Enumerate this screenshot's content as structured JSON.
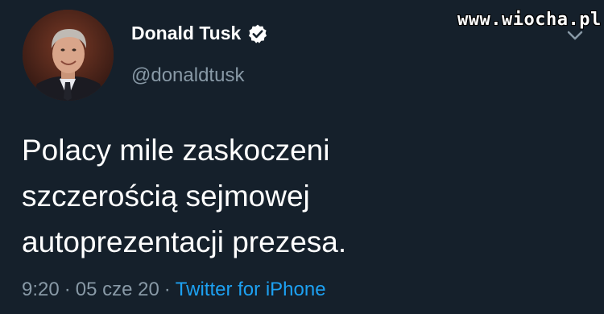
{
  "watermark": {
    "text": "www.wiocha.pl"
  },
  "author": {
    "display_name": "Donald Tusk",
    "handle": "@donaldtusk",
    "verified": true,
    "avatar_icon": "profile-photo"
  },
  "tweet": {
    "text_lines": [
      "Polacy mile zaskoczeni",
      "szczerością sejmowej",
      "autoprezentacji prezesa."
    ],
    "time": "9:20",
    "separator": "·",
    "date": "05 cze 20",
    "source": "Twitter for iPhone"
  },
  "icons": {
    "verified": "verified-badge-icon",
    "menu": "chevron-down-icon"
  },
  "colors": {
    "background": "#15202b",
    "text": "#ffffff",
    "secondary_text": "#8899a6",
    "link": "#1da1f2"
  }
}
